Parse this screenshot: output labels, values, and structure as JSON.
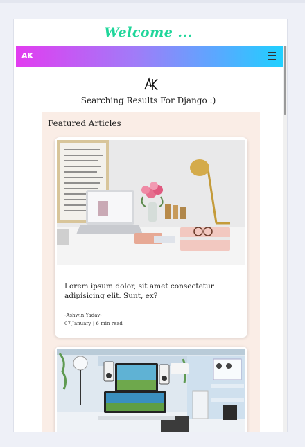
{
  "header": {
    "welcome": "Welcome ..."
  },
  "navbar": {
    "brand": "AK",
    "accent_start": "#e23cf0",
    "accent_end": "#1fd0ff",
    "menu_icon": "hamburger-icon"
  },
  "logo": {
    "text": "AK"
  },
  "search": {
    "results_title": "Searching Results For Django :)"
  },
  "featured": {
    "heading": "Featured Articles",
    "articles": [
      {
        "title": "Lorem ipsum dolor, sit amet consectetur adipisicing elit. Sunt, ex?",
        "author": "-Ashwin Yadav-",
        "meta": "07 January | 6 min read",
        "image": "desk-workspace-image"
      },
      {
        "image": "gaming-setup-image"
      }
    ]
  },
  "colors": {
    "welcome_text": "#1fd69a",
    "panel_bg": "#faede6"
  }
}
